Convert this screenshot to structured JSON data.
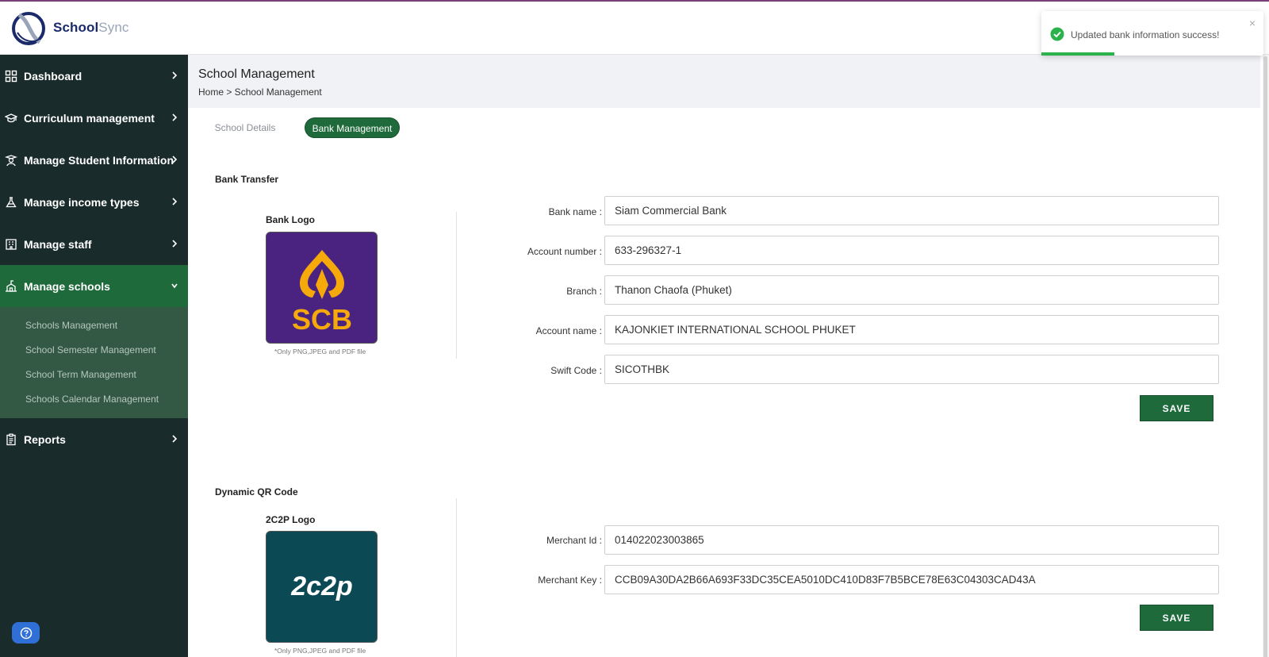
{
  "brand": {
    "part1": "School",
    "part2": "Sync"
  },
  "sidebar": {
    "items": [
      {
        "label": "Dashboard",
        "icon": "grid-icon"
      },
      {
        "label": "Curriculum management",
        "icon": "graduation-cap-icon"
      },
      {
        "label": "Manage Student Information",
        "icon": "student-icon"
      },
      {
        "label": "Manage income types",
        "icon": "flask-icon"
      },
      {
        "label": "Manage staff",
        "icon": "building-icon"
      },
      {
        "label": "Manage schools",
        "icon": "school-icon",
        "active": true
      },
      {
        "label": "Reports",
        "icon": "clipboard-icon"
      }
    ],
    "submenu": [
      "Schools Management",
      "School Semester Management",
      "School Term Management",
      "Schools Calendar Management"
    ]
  },
  "header": {
    "title": "School Management",
    "breadcrumb": "Home > School Management"
  },
  "tabs": [
    {
      "label": "School Details",
      "active": false
    },
    {
      "label": "Bank Management",
      "active": true
    }
  ],
  "bank_transfer": {
    "title": "Bank Transfer",
    "logo_label": "Bank Logo",
    "logo_text": "SCB",
    "logo_note": "*Only PNG,JPEG and PDF file",
    "fields": [
      {
        "label": "Bank name :",
        "value": "Siam Commercial Bank"
      },
      {
        "label": "Account number :",
        "value": "633-296327-1"
      },
      {
        "label": "Branch :",
        "value": "Thanon Chaofa (Phuket)"
      },
      {
        "label": "Account name :",
        "value": "KAJONKIET INTERNATIONAL SCHOOL PHUKET"
      },
      {
        "label": "Swift Code :",
        "value": "SICOTHBK"
      }
    ],
    "save_label": "SAVE"
  },
  "dynamic_qr": {
    "title": "Dynamic QR Code",
    "logo_label": "2C2P Logo",
    "logo_text": "2c2p",
    "logo_note": "*Only PNG,JPEG and PDF file",
    "fields": [
      {
        "label": "Merchant Id :",
        "value": "014022023003865"
      },
      {
        "label": "Merchant Key :",
        "value": "CCB09A30DA2B66A693F33DC35CEA5010DC410D83F7B5BCE78E63C04303CAD43A"
      }
    ],
    "save_label": "SAVE"
  },
  "toast": {
    "message": "Updated bank information success!",
    "close": "×",
    "progress": 0.33
  },
  "colors": {
    "primary": "#1f6a3b",
    "sidebar": "#1a2b2c",
    "scb_purple": "#4a2380",
    "scb_gold": "#f5a90a",
    "twoc2p_teal": "#0b4a55",
    "success": "#2bb24a"
  }
}
